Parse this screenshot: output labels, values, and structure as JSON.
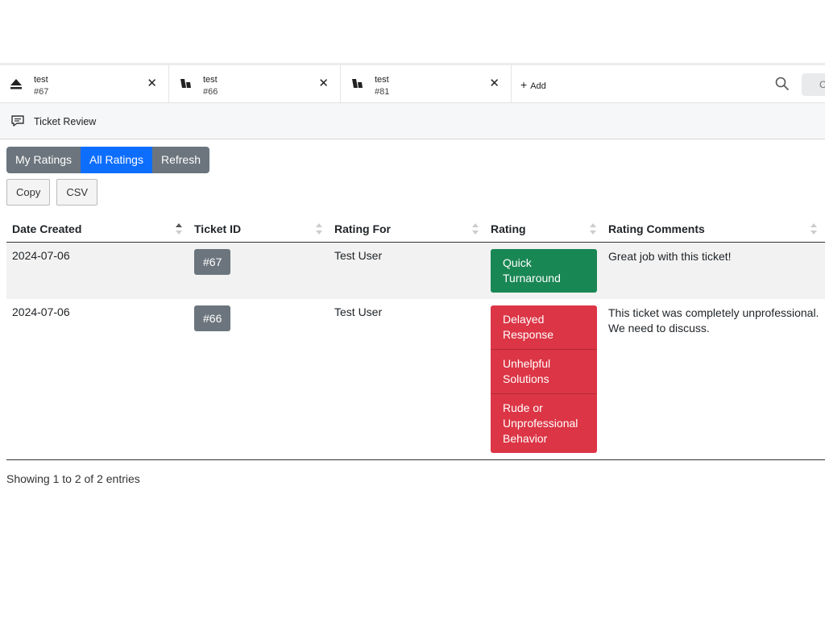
{
  "tabs": [
    {
      "title": "test",
      "sub": "#67",
      "icon": "eject-icon"
    },
    {
      "title": "test",
      "sub": "#66",
      "icon": "ticket-icon"
    },
    {
      "title": "test",
      "sub": "#81",
      "icon": "ticket-icon"
    }
  ],
  "add_tab": {
    "label": "Add"
  },
  "search": {
    "placeholder": "C"
  },
  "subheader": {
    "title": "Ticket Review"
  },
  "view_buttons": {
    "my_ratings": "My Ratings",
    "all_ratings": "All Ratings",
    "refresh": "Refresh",
    "active": "All Ratings"
  },
  "export_buttons": {
    "copy": "Copy",
    "csv": "CSV"
  },
  "table": {
    "columns": [
      "Date Created",
      "Ticket ID",
      "Rating For",
      "Rating",
      "Rating Comments"
    ],
    "rows": [
      {
        "date": "2024-07-06",
        "ticket_id": "#67",
        "rating_for": "Test User",
        "ratings": [
          {
            "label": "Quick Turnaround",
            "kind": "positive"
          }
        ],
        "comment": "Great job with this ticket!"
      },
      {
        "date": "2024-07-06",
        "ticket_id": "#66",
        "rating_for": "Test User",
        "ratings": [
          {
            "label": "Delayed Response",
            "kind": "negative"
          },
          {
            "label": "Unhelpful Solutions",
            "kind": "negative"
          },
          {
            "label": "Rude or Unprofessional Behavior",
            "kind": "negative"
          }
        ],
        "comment": "This ticket was completely unprofessional. We need to discuss."
      }
    ]
  },
  "footer": {
    "info": "Showing 1 to 2 of 2 entries"
  },
  "colors": {
    "primary": "#0d6efd",
    "secondary": "#6c757d",
    "positive": "#198754",
    "negative": "#dc3545"
  }
}
